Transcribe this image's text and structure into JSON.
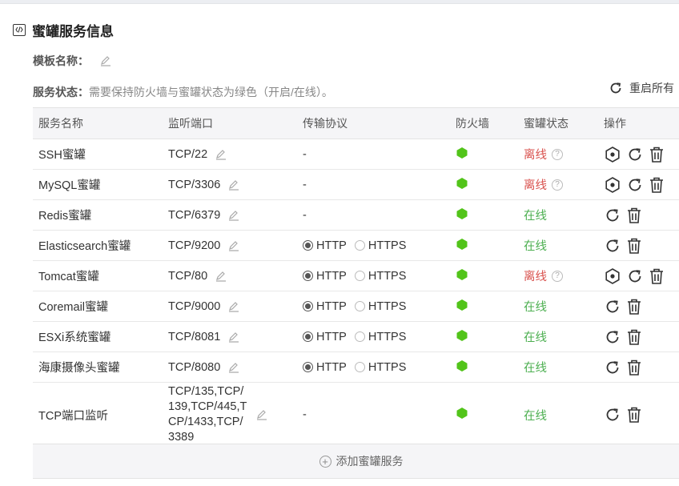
{
  "section": {
    "title": "蜜罐服务信息",
    "icon": "code-icon"
  },
  "template": {
    "label": "模板名称："
  },
  "service_status": {
    "label": "服务状态：",
    "hint": "需要保持防火墙与蜜罐状态为绿色（开启/在线）。"
  },
  "restart_all": {
    "label": "重启所有"
  },
  "columns": [
    "服务名称",
    "监听端口",
    "传输协议",
    "防火墙",
    "蜜罐状态",
    "操作"
  ],
  "rows": [
    {
      "name": "SSH蜜罐",
      "port": "TCP/22",
      "protocol": "-",
      "status": "离线"
    },
    {
      "name": "MySQL蜜罐",
      "port": "TCP/3306",
      "protocol": "-",
      "status": "离线"
    },
    {
      "name": "Redis蜜罐",
      "port": "TCP/6379",
      "protocol": "-",
      "status": "在线"
    },
    {
      "name": "Elasticsearch蜜罐",
      "port": "TCP/9200",
      "protocol_options": [
        "HTTP",
        "HTTPS"
      ],
      "protocol_selected": "HTTP",
      "status": "在线"
    },
    {
      "name": "Tomcat蜜罐",
      "port": "TCP/80",
      "protocol_options": [
        "HTTP",
        "HTTPS"
      ],
      "protocol_selected": "HTTP",
      "status": "离线"
    },
    {
      "name": "Coremail蜜罐",
      "port": "TCP/9000",
      "protocol_options": [
        "HTTP",
        "HTTPS"
      ],
      "protocol_selected": "HTTP",
      "status": "在线"
    },
    {
      "name": "ESXi系统蜜罐",
      "port": "TCP/8081",
      "protocol_options": [
        "HTTP",
        "HTTPS"
      ],
      "protocol_selected": "HTTP",
      "status": "在线"
    },
    {
      "name": "海康摄像头蜜罐",
      "port": "TCP/8080",
      "protocol_options": [
        "HTTP",
        "HTTPS"
      ],
      "protocol_selected": "HTTP",
      "status": "在线"
    },
    {
      "name": "TCP端口监听",
      "port": "TCP/135,TCP/139,TCP/445,TCP/1433,TCP/3389",
      "protocol": "-",
      "status": "在线"
    }
  ],
  "add_service": {
    "label": "添加蜜罐服务"
  },
  "colors": {
    "online": "#4caf50",
    "offline": "#d9534f",
    "firewall_on": "#52c41a"
  }
}
